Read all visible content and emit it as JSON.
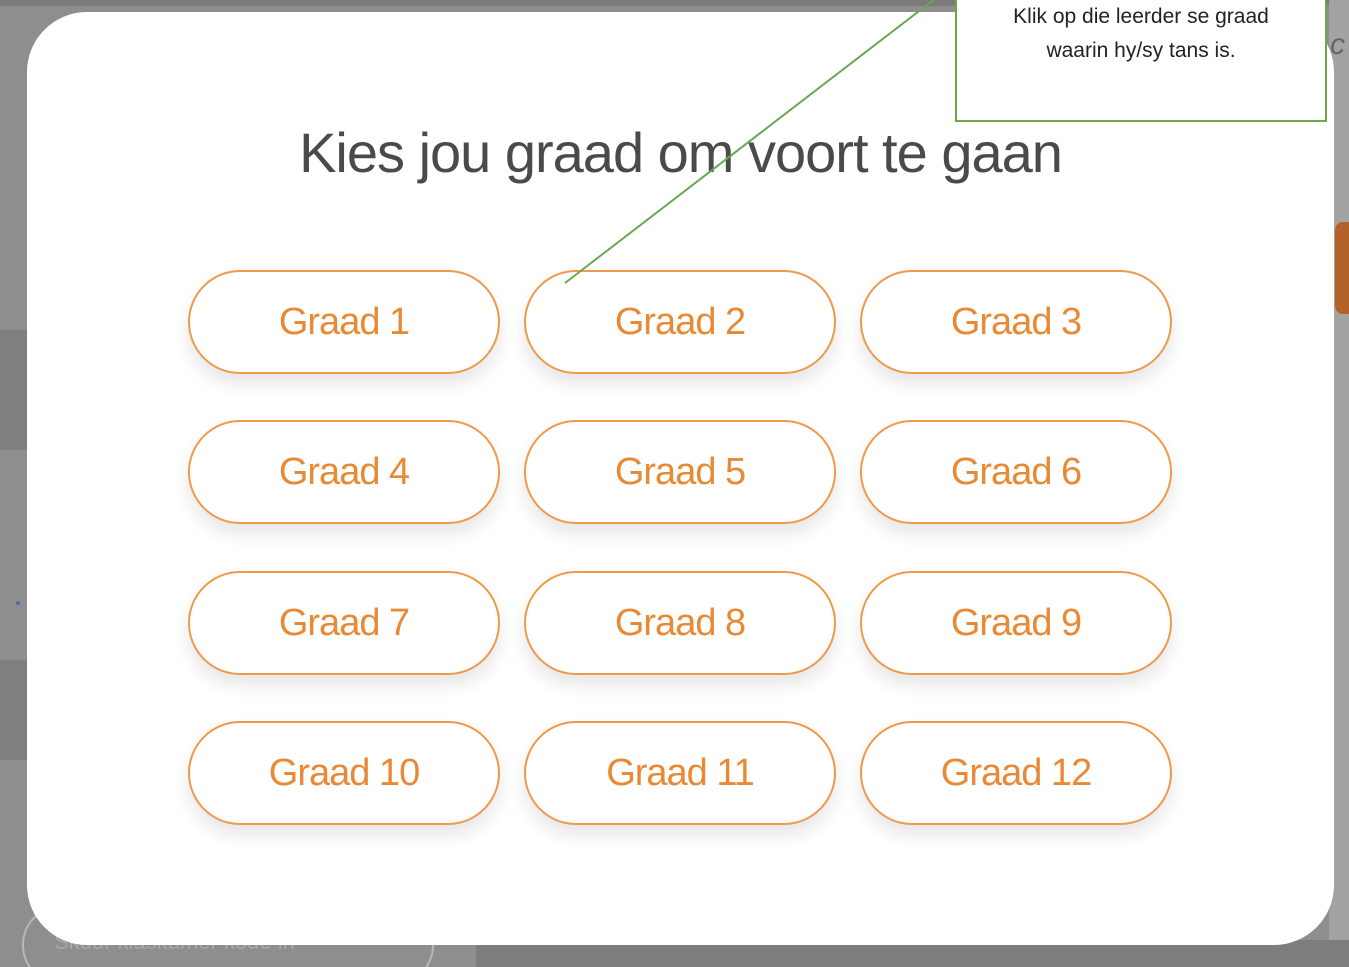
{
  "modal": {
    "title": "Kies jou graad om voort te gaan",
    "grades": [
      "Graad 1",
      "Graad 2",
      "Graad 3",
      "Graad 4",
      "Graad 5",
      "Graad 6",
      "Graad 7",
      "Graad 8",
      "Graad 9",
      "Graad 10",
      "Graad 11",
      "Graad 12"
    ]
  },
  "annotation": {
    "line1": "Klik op die leerder se graad",
    "line2": "waarin hy/sy tans is."
  },
  "background": {
    "partial_button_text": "Skuur klaskamer kode in",
    "edge_glyph": "c"
  },
  "colors": {
    "accent": "#e88a35",
    "button_border": "#ee9a4a",
    "annotation_border": "#6aa84f"
  }
}
